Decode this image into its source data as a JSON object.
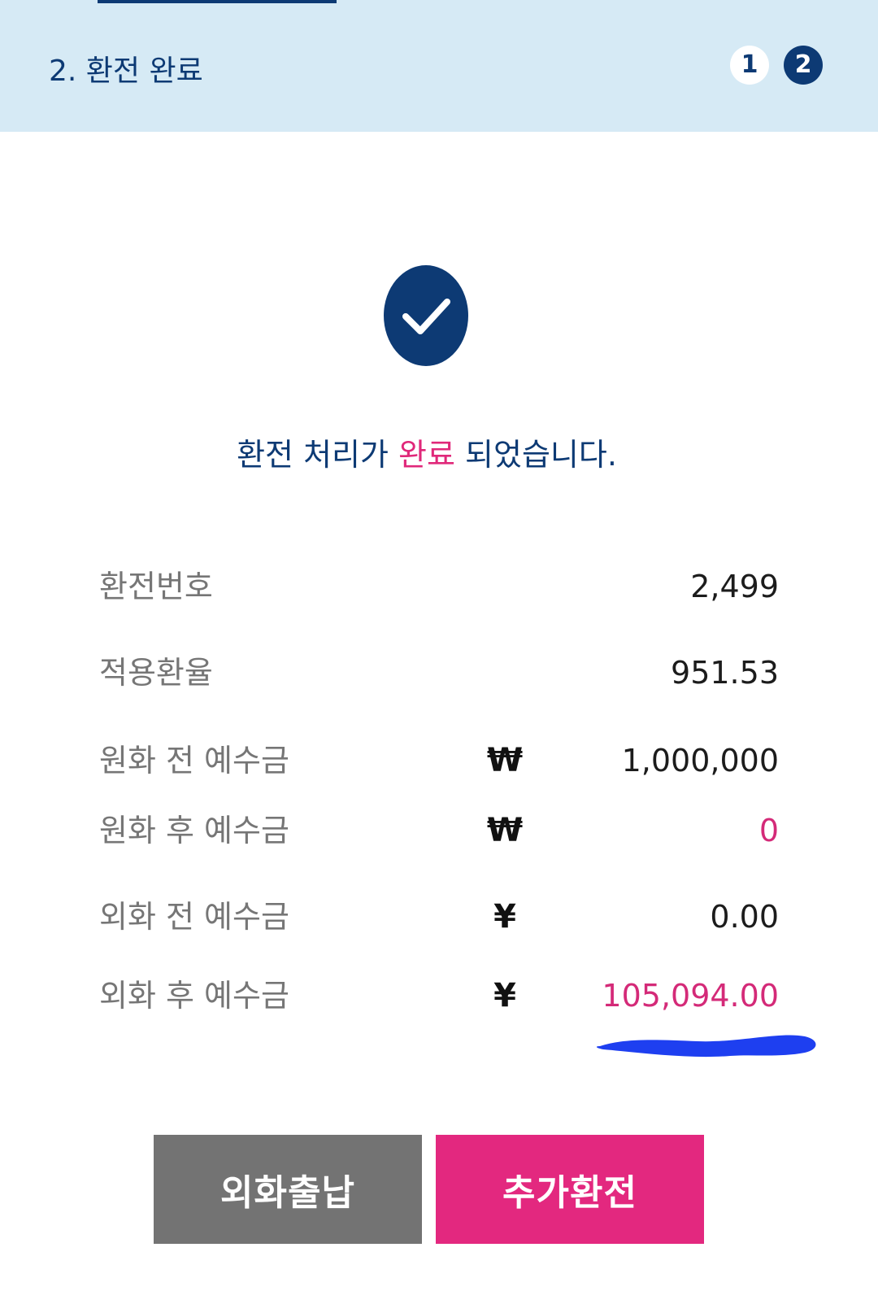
{
  "header": {
    "title": "2. 환전 완료",
    "steps": [
      "1",
      "2"
    ]
  },
  "status": {
    "icon": "check-circle-icon",
    "message_before": "환전 처리가 ",
    "message_highlight": "완료",
    "message_after": " 되었습니다."
  },
  "details": [
    {
      "label": "환전번호",
      "symbol": "",
      "value": "2,499"
    },
    {
      "label": "적용환율",
      "symbol": "",
      "value": "951.53"
    },
    {
      "label": "원화 전 예수금",
      "symbol": "₩",
      "value": "1,000,000"
    },
    {
      "label": "원화 후 예수금",
      "symbol": "₩",
      "value": "0"
    },
    {
      "label": "외화 전 예수금",
      "symbol": "¥",
      "value": "0.00"
    },
    {
      "label": "외화 후 예수금",
      "symbol": "¥",
      "value": "105,094.00"
    }
  ],
  "buttons": {
    "foreign_deposit_withdraw": "외화출납",
    "additional_exchange": "추가환전"
  },
  "colors": {
    "navy": "#0d3a74",
    "header_bg": "#d6eaf5",
    "accent_pink": "#e3287f",
    "button_gray": "#737373",
    "marker_blue": "#1e3ff0"
  }
}
